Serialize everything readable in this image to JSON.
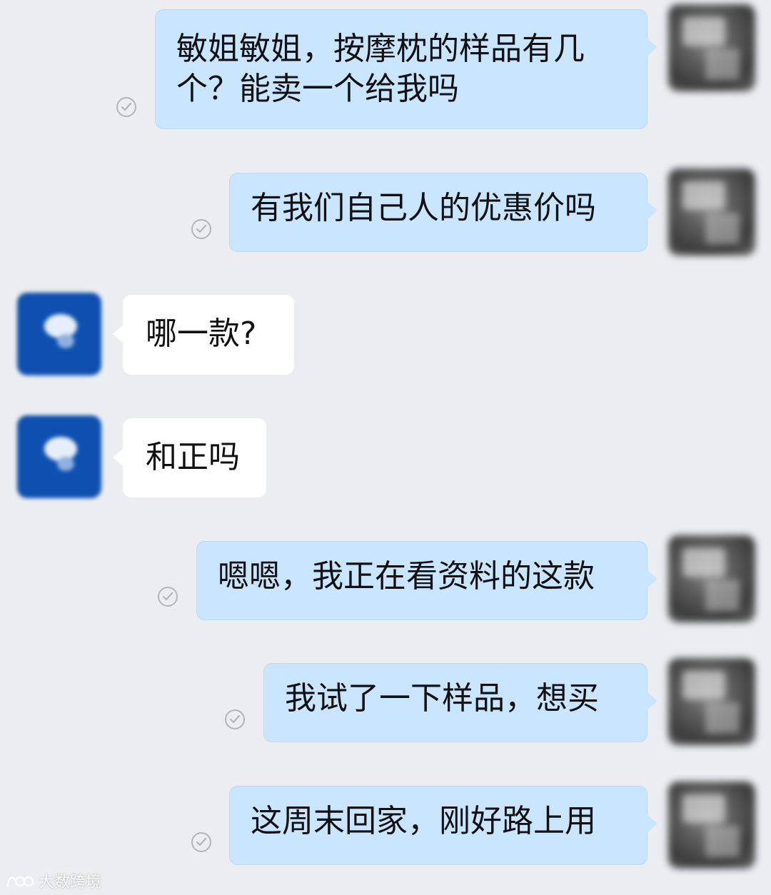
{
  "messages": [
    {
      "direction": "out",
      "text": "敏姐敏姐，按摩枕的样品有几\n个？能卖一个给我吗",
      "read": true
    },
    {
      "direction": "out",
      "text": "有我们自己人的优惠价吗",
      "read": true
    },
    {
      "direction": "in",
      "text": "哪一款?"
    },
    {
      "direction": "in",
      "text": "和正吗"
    },
    {
      "direction": "out",
      "text": "嗯嗯，我正在看资料的这款",
      "read": true
    },
    {
      "direction": "out",
      "text": "我试了一下样品，想买",
      "read": true
    },
    {
      "direction": "out",
      "text": "这周末回家，刚好路上用",
      "read": true
    }
  ],
  "icons": {
    "read_status": "check-circle-icon",
    "self_avatar": "avatar-blurred",
    "contact_avatar": "avatar-blurred-blue"
  },
  "watermark": {
    "text": "大数跨境"
  },
  "colors": {
    "background": "#ebedf0",
    "outgoing_bubble": "#c9e5ff",
    "incoming_bubble": "#ffffff",
    "read_check": "#b3b5b8",
    "contact_avatar": "#0e4fb0"
  }
}
